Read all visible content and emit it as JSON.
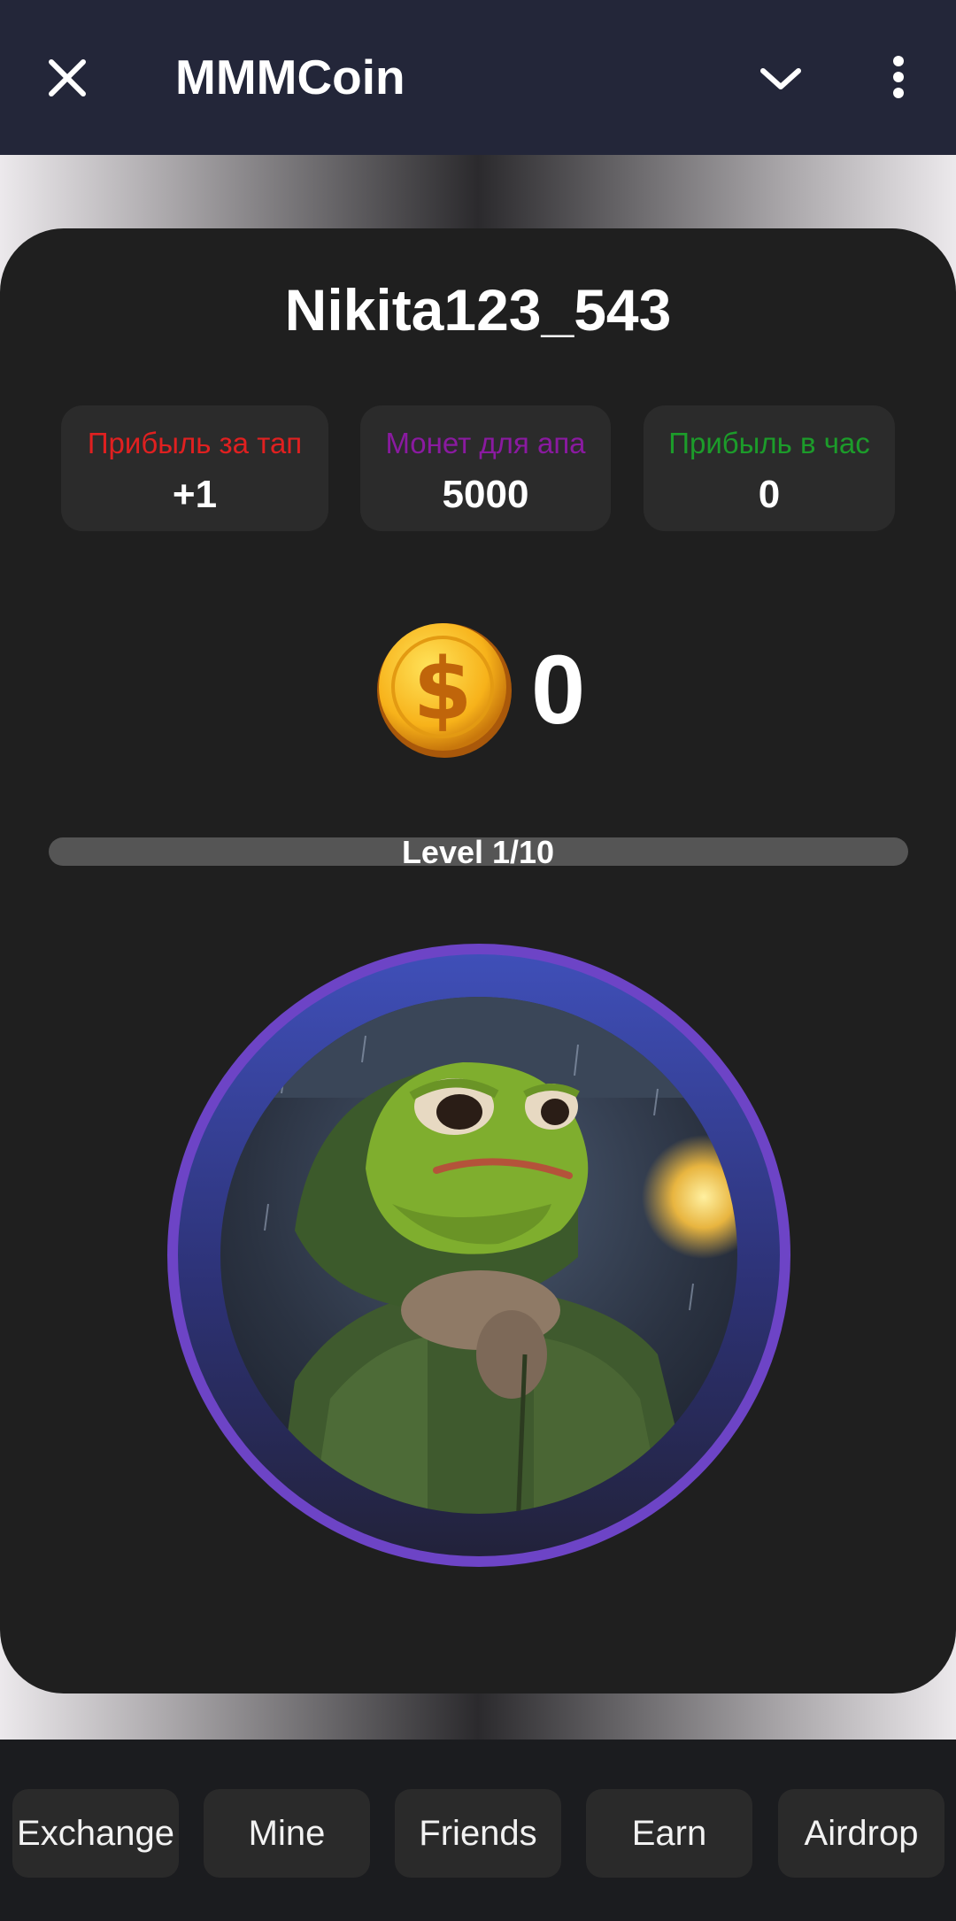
{
  "header": {
    "title": "MMMCoin",
    "close_icon": "close-icon",
    "dropdown_icon": "chevron-down-icon",
    "menu_icon": "more-vert-icon"
  },
  "profile": {
    "username": "Nikita123_543"
  },
  "stats": [
    {
      "label": "Прибыль за тап",
      "value": "+1",
      "color": "#e02020"
    },
    {
      "label": "Монет для апа",
      "value": "5000",
      "color": "#8a1aa0"
    },
    {
      "label": "Прибыль в час",
      "value": "0",
      "color": "#1c9c2a"
    }
  ],
  "balance": {
    "icon": "dollar-coin-icon",
    "amount": "0"
  },
  "level": {
    "label": "Level 1/10",
    "progress": 0
  },
  "tap_target": {
    "icon": "frog-avatar-image",
    "ring_color": "#6d44c6"
  },
  "nav": [
    {
      "label": "Exchange"
    },
    {
      "label": "Mine"
    },
    {
      "label": "Friends"
    },
    {
      "label": "Earn"
    },
    {
      "label": "Airdrop"
    }
  ]
}
